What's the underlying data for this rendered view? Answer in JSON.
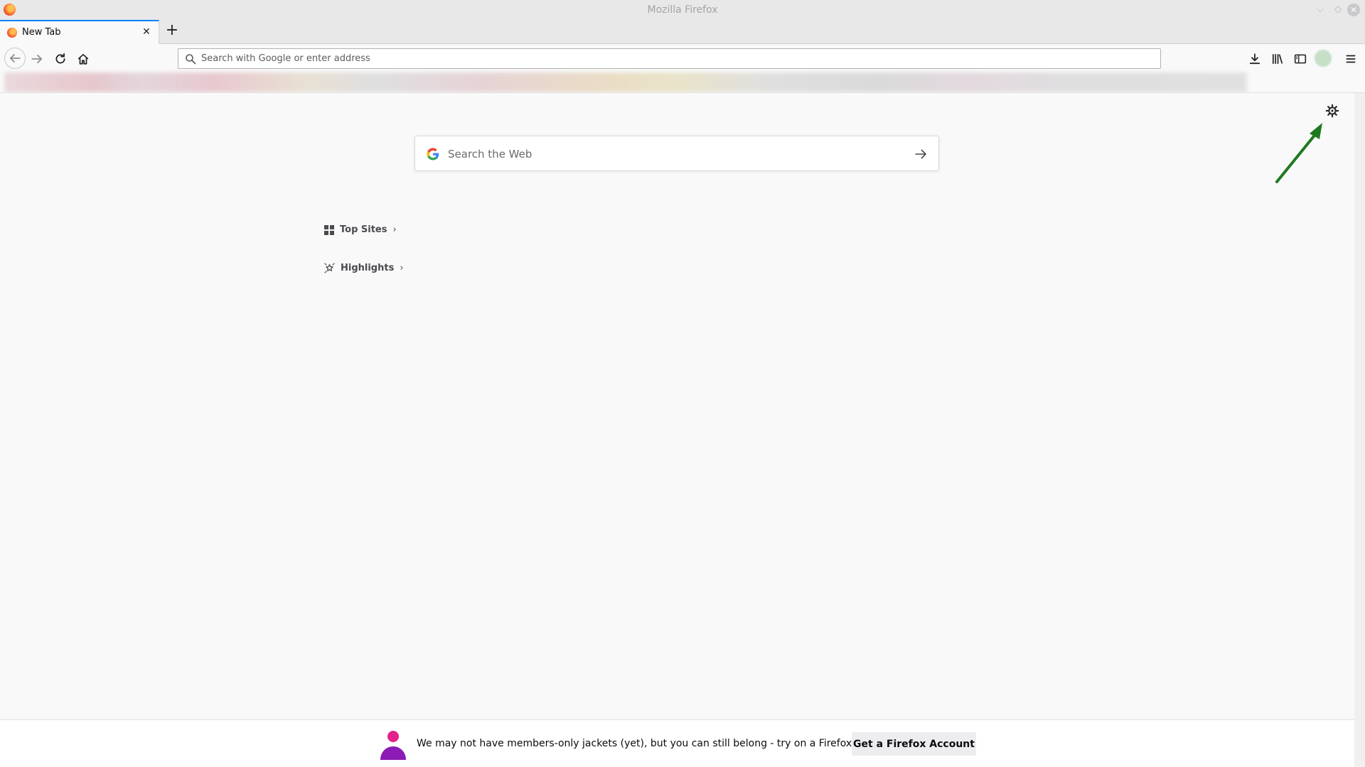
{
  "window": {
    "title": "Mozilla Firefox",
    "controls": {
      "minimize": "⌵",
      "maximize": "◇",
      "close": "✕"
    }
  },
  "tabs": [
    {
      "label": "New Tab",
      "active": true,
      "icon": "firefox-icon"
    }
  ],
  "tab_controls": {
    "close": "✕",
    "new_tab": "+"
  },
  "navbar": {
    "url_placeholder": "Search with Google or enter address",
    "icons": [
      "back-icon",
      "forward-icon",
      "reload-icon",
      "home-icon",
      "download-icon",
      "library-icon",
      "sidebar-icon",
      "account-avatar",
      "menu-icon"
    ]
  },
  "newtab": {
    "search_placeholder": "Search the Web",
    "sections": [
      {
        "label": "Top Sites",
        "chevron": "›",
        "icon": "grid-icon"
      },
      {
        "label": "Highlights",
        "chevron": "›",
        "icon": "highlights-icon"
      }
    ],
    "settings_icon": "gear-icon",
    "annotation_color": "#1e7a1e"
  },
  "snippet": {
    "text": "We may not have members-only jackets (yet), but you can still belong - try on a Firefox Account.",
    "button_label": "Get a Firefox Account",
    "icon_colors": {
      "head": "#e5228b",
      "body": "#8c1bb5"
    }
  },
  "colors": {
    "accent": "#0a84ff",
    "chrome_bg": "#e8e8e9",
    "page_bg": "#f9f9fa"
  }
}
